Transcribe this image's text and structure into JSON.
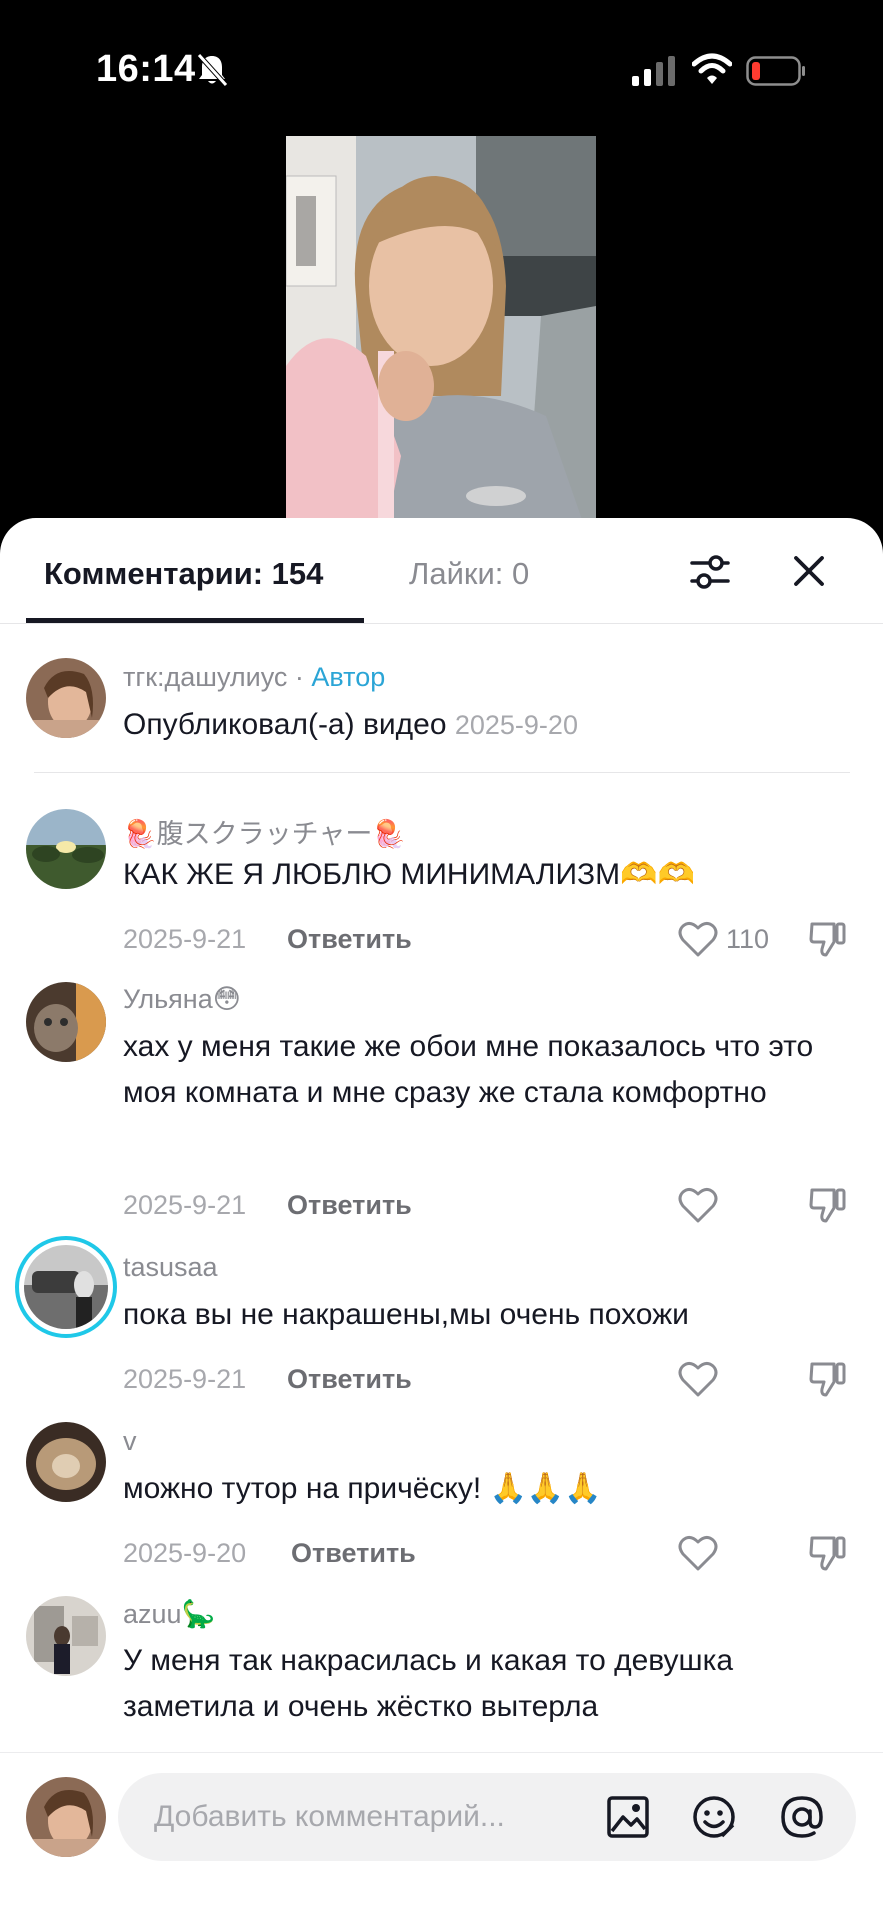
{
  "status_bar": {
    "time": "16:14"
  },
  "tabs": {
    "comments": "Комментарии: 154",
    "likes": "Лайки: 0"
  },
  "comments": [
    {
      "username": "тгк:дашулиус",
      "separator": " · ",
      "badge": "Автор",
      "text": "Опубликовал(-а) видео",
      "date": "2025-9-20"
    },
    {
      "username": "🪼腹スクラッチャー🪼",
      "text": "КАК ЖЕ Я ЛЮБЛЮ МИНИМАЛИЗМ🫶🫶",
      "date": "2025-9-21",
      "reply": "Ответить",
      "likes": "110"
    },
    {
      "username": "Ульяна😳",
      "text": "хах у меня такие же обои мне показалось что это моя комната и мне сразу же стала комфортно",
      "date": "2025-9-21",
      "reply": "Ответить"
    },
    {
      "username": "tasusaa",
      "text": "пока вы не накрашены,мы очень похожи",
      "date": "2025-9-21",
      "reply": "Ответить"
    },
    {
      "username": "v",
      "text": "можно тутор на причёску! 🙏🙏🙏",
      "date": "2025-9-20",
      "reply": "Ответить"
    },
    {
      "username": "azuu🦕",
      "text": "У меня так накрасилась и какая то девушка заметила и очень жёстко вытерла"
    }
  ],
  "input": {
    "placeholder": "Добавить комментарий..."
  },
  "icons": {
    "silent": "bell-slash-icon",
    "signal": "cellular-signal-icon",
    "wifi": "wifi-icon",
    "battery": "battery-low-icon",
    "filter": "sliders-icon",
    "close": "close-icon",
    "like": "heart-outline-icon",
    "dislike": "thumbs-down-icon",
    "image": "image-icon",
    "emoji": "emoji-icon",
    "mention": "at-mention-icon"
  },
  "colors": {
    "author_badge": "#2ba5d6",
    "battery_low": "#ff3b30",
    "story_ring": "#1fc8e8"
  }
}
